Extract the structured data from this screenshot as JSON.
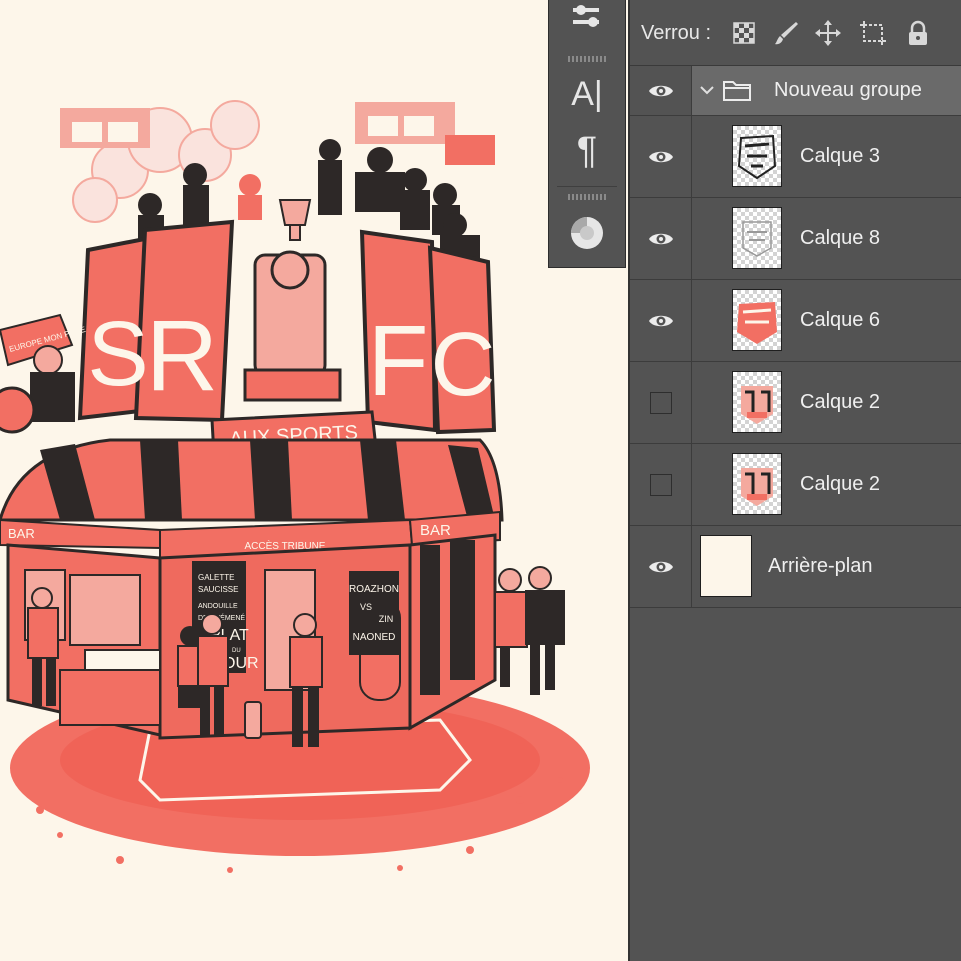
{
  "lock_bar": {
    "label": "Verrou :",
    "icons": [
      "lock-transparent-pixels-icon",
      "lock-image-pixels-icon",
      "lock-position-icon",
      "lock-artboard-icon",
      "lock-all-icon"
    ]
  },
  "toolstrip": {
    "tools": [
      "adjust-icon",
      "character-panel-icon",
      "paragraph-icon",
      "styles-icon"
    ],
    "character_glyph": "A|",
    "paragraph_glyph": "¶"
  },
  "layers": [
    {
      "name": "Nouveau groupe",
      "kind": "group",
      "visible": true,
      "expanded": true,
      "selected": true
    },
    {
      "name": "Calque 3",
      "kind": "layer",
      "visible": true,
      "indent": true
    },
    {
      "name": "Calque 8",
      "kind": "layer",
      "visible": true,
      "indent": true
    },
    {
      "name": "Calque 6",
      "kind": "layer",
      "visible": true,
      "indent": true
    },
    {
      "name": "Calque 2",
      "kind": "layer",
      "visible": false,
      "indent": true
    },
    {
      "name": "Calque 2",
      "kind": "layer",
      "visible": false,
      "indent": true
    },
    {
      "name": "Arrière-plan",
      "kind": "background",
      "visible": true,
      "indent": false
    }
  ],
  "artwork": {
    "banner_letters": [
      "S",
      "R",
      "F",
      "C"
    ],
    "sign_main": "AUX SPORTS",
    "awning_label_left": "BAR",
    "awning_label_right": "BAR",
    "entrance_sign": "ACCÈS TRIBUNE",
    "menu_board": [
      "GALETTE",
      "SAUCISSE",
      "ANDOUILLE",
      "DE GUÉMENÉ",
      "PLAT",
      "DU",
      "JOUR"
    ],
    "poster_text": [
      "ROAZHON",
      "VS",
      "ZIN",
      "NAONED"
    ],
    "scarf_text": "EUROPE MON POTE",
    "colors": {
      "coral": "#f26f63",
      "pink": "#f4a99e",
      "ink": "#2d2827",
      "cream": "#fdf6ea"
    }
  }
}
